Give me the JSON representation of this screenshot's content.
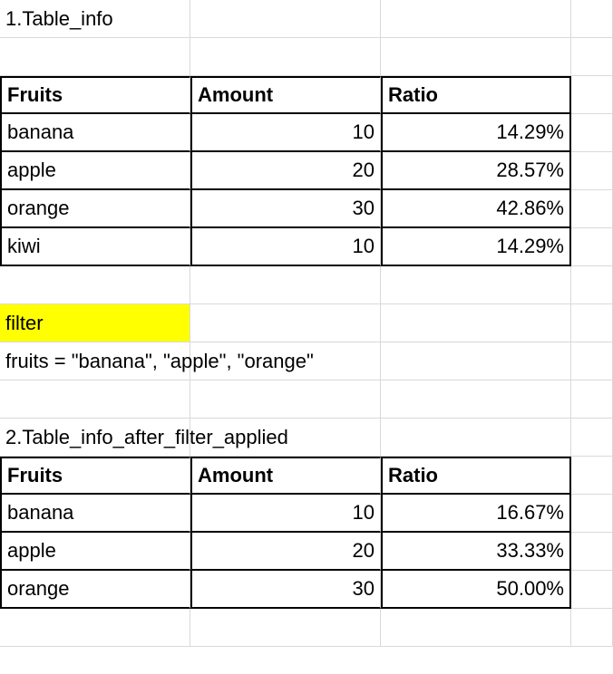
{
  "section1": {
    "title": "1.Table_info",
    "headers": {
      "c1": "Fruits",
      "c2": "Amount",
      "c3": "Ratio"
    },
    "rows": [
      {
        "fruit": "banana",
        "amount": "10",
        "ratio": "14.29%"
      },
      {
        "fruit": "apple",
        "amount": "20",
        "ratio": "28.57%"
      },
      {
        "fruit": "orange",
        "amount": "30",
        "ratio": "42.86%"
      },
      {
        "fruit": "kiwi",
        "amount": "10",
        "ratio": "14.29%"
      }
    ]
  },
  "filter": {
    "label": "filter",
    "expression": "fruits = \"banana\", \"apple\", \"orange\""
  },
  "section2": {
    "title": "2.Table_info_after_filter_applied",
    "headers": {
      "c1": "Fruits",
      "c2": "Amount",
      "c3": "Ratio"
    },
    "rows": [
      {
        "fruit": "banana",
        "amount": "10",
        "ratio": "16.67%"
      },
      {
        "fruit": "apple",
        "amount": "20",
        "ratio": "33.33%"
      },
      {
        "fruit": "orange",
        "amount": "30",
        "ratio": "50.00%"
      }
    ]
  },
  "chart_data": [
    {
      "type": "table",
      "title": "1.Table_info",
      "columns": [
        "Fruits",
        "Amount",
        "Ratio"
      ],
      "rows": [
        [
          "banana",
          10,
          "14.29%"
        ],
        [
          "apple",
          20,
          "28.57%"
        ],
        [
          "orange",
          30,
          "42.86%"
        ],
        [
          "kiwi",
          10,
          "14.29%"
        ]
      ]
    },
    {
      "type": "table",
      "title": "2.Table_info_after_filter_applied",
      "columns": [
        "Fruits",
        "Amount",
        "Ratio"
      ],
      "rows": [
        [
          "banana",
          10,
          "16.67%"
        ],
        [
          "apple",
          20,
          "33.33%"
        ],
        [
          "orange",
          30,
          "50.00%"
        ]
      ]
    }
  ]
}
